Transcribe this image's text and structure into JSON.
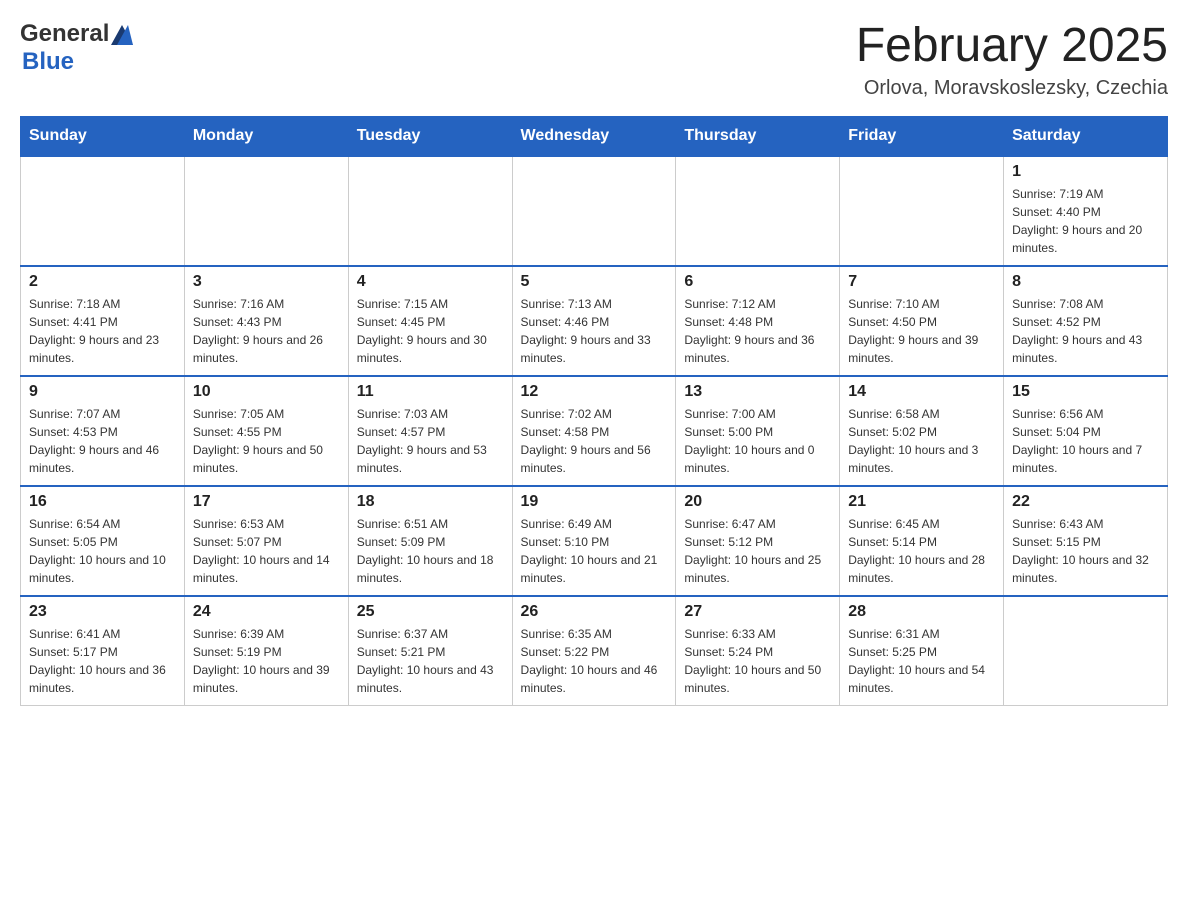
{
  "header": {
    "logo_general": "General",
    "logo_blue": "Blue",
    "title": "February 2025",
    "location": "Orlova, Moravskoslezsky, Czechia"
  },
  "calendar": {
    "days_of_week": [
      "Sunday",
      "Monday",
      "Tuesday",
      "Wednesday",
      "Thursday",
      "Friday",
      "Saturday"
    ],
    "weeks": [
      [
        {
          "day": "",
          "info": ""
        },
        {
          "day": "",
          "info": ""
        },
        {
          "day": "",
          "info": ""
        },
        {
          "day": "",
          "info": ""
        },
        {
          "day": "",
          "info": ""
        },
        {
          "day": "",
          "info": ""
        },
        {
          "day": "1",
          "info": "Sunrise: 7:19 AM\nSunset: 4:40 PM\nDaylight: 9 hours and 20 minutes."
        }
      ],
      [
        {
          "day": "2",
          "info": "Sunrise: 7:18 AM\nSunset: 4:41 PM\nDaylight: 9 hours and 23 minutes."
        },
        {
          "day": "3",
          "info": "Sunrise: 7:16 AM\nSunset: 4:43 PM\nDaylight: 9 hours and 26 minutes."
        },
        {
          "day": "4",
          "info": "Sunrise: 7:15 AM\nSunset: 4:45 PM\nDaylight: 9 hours and 30 minutes."
        },
        {
          "day": "5",
          "info": "Sunrise: 7:13 AM\nSunset: 4:46 PM\nDaylight: 9 hours and 33 minutes."
        },
        {
          "day": "6",
          "info": "Sunrise: 7:12 AM\nSunset: 4:48 PM\nDaylight: 9 hours and 36 minutes."
        },
        {
          "day": "7",
          "info": "Sunrise: 7:10 AM\nSunset: 4:50 PM\nDaylight: 9 hours and 39 minutes."
        },
        {
          "day": "8",
          "info": "Sunrise: 7:08 AM\nSunset: 4:52 PM\nDaylight: 9 hours and 43 minutes."
        }
      ],
      [
        {
          "day": "9",
          "info": "Sunrise: 7:07 AM\nSunset: 4:53 PM\nDaylight: 9 hours and 46 minutes."
        },
        {
          "day": "10",
          "info": "Sunrise: 7:05 AM\nSunset: 4:55 PM\nDaylight: 9 hours and 50 minutes."
        },
        {
          "day": "11",
          "info": "Sunrise: 7:03 AM\nSunset: 4:57 PM\nDaylight: 9 hours and 53 minutes."
        },
        {
          "day": "12",
          "info": "Sunrise: 7:02 AM\nSunset: 4:58 PM\nDaylight: 9 hours and 56 minutes."
        },
        {
          "day": "13",
          "info": "Sunrise: 7:00 AM\nSunset: 5:00 PM\nDaylight: 10 hours and 0 minutes."
        },
        {
          "day": "14",
          "info": "Sunrise: 6:58 AM\nSunset: 5:02 PM\nDaylight: 10 hours and 3 minutes."
        },
        {
          "day": "15",
          "info": "Sunrise: 6:56 AM\nSunset: 5:04 PM\nDaylight: 10 hours and 7 minutes."
        }
      ],
      [
        {
          "day": "16",
          "info": "Sunrise: 6:54 AM\nSunset: 5:05 PM\nDaylight: 10 hours and 10 minutes."
        },
        {
          "day": "17",
          "info": "Sunrise: 6:53 AM\nSunset: 5:07 PM\nDaylight: 10 hours and 14 minutes."
        },
        {
          "day": "18",
          "info": "Sunrise: 6:51 AM\nSunset: 5:09 PM\nDaylight: 10 hours and 18 minutes."
        },
        {
          "day": "19",
          "info": "Sunrise: 6:49 AM\nSunset: 5:10 PM\nDaylight: 10 hours and 21 minutes."
        },
        {
          "day": "20",
          "info": "Sunrise: 6:47 AM\nSunset: 5:12 PM\nDaylight: 10 hours and 25 minutes."
        },
        {
          "day": "21",
          "info": "Sunrise: 6:45 AM\nSunset: 5:14 PM\nDaylight: 10 hours and 28 minutes."
        },
        {
          "day": "22",
          "info": "Sunrise: 6:43 AM\nSunset: 5:15 PM\nDaylight: 10 hours and 32 minutes."
        }
      ],
      [
        {
          "day": "23",
          "info": "Sunrise: 6:41 AM\nSunset: 5:17 PM\nDaylight: 10 hours and 36 minutes."
        },
        {
          "day": "24",
          "info": "Sunrise: 6:39 AM\nSunset: 5:19 PM\nDaylight: 10 hours and 39 minutes."
        },
        {
          "day": "25",
          "info": "Sunrise: 6:37 AM\nSunset: 5:21 PM\nDaylight: 10 hours and 43 minutes."
        },
        {
          "day": "26",
          "info": "Sunrise: 6:35 AM\nSunset: 5:22 PM\nDaylight: 10 hours and 46 minutes."
        },
        {
          "day": "27",
          "info": "Sunrise: 6:33 AM\nSunset: 5:24 PM\nDaylight: 10 hours and 50 minutes."
        },
        {
          "day": "28",
          "info": "Sunrise: 6:31 AM\nSunset: 5:25 PM\nDaylight: 10 hours and 54 minutes."
        },
        {
          "day": "",
          "info": ""
        }
      ]
    ]
  }
}
